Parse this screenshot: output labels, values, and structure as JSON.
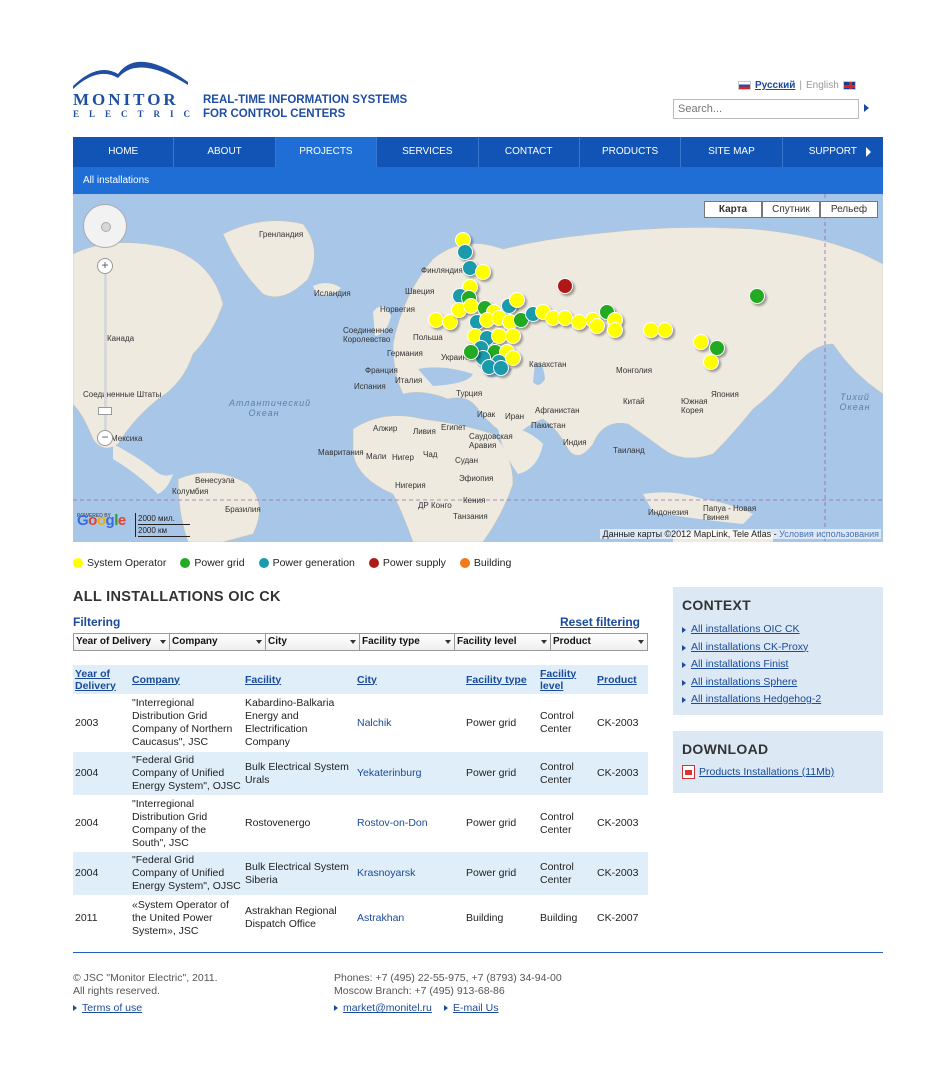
{
  "header": {
    "logo_word": "MONITOR",
    "logo_sub": "ELECTRIC",
    "tagline_1": "REAL-TIME INFORMATION SYSTEMS",
    "tagline_2": "FOR CONTROL CENTERS",
    "lang_ru": "Русский",
    "lang_sep": "|",
    "lang_en": "English",
    "search_placeholder": "Search..."
  },
  "nav": {
    "items": [
      "HOME",
      "ABOUT",
      "PROJECTS",
      "SERVICES",
      "CONTACT",
      "PRODUCTS",
      "SITE MAP",
      "SUPPORT"
    ],
    "active": "PROJECTS",
    "subnav": "All installations"
  },
  "map": {
    "type_buttons": [
      "Карта",
      "Спутник",
      "Рельеф"
    ],
    "active_type": "Карта",
    "labels": [
      "Гренландия",
      "Исландия",
      "Финляндия",
      "Швеция",
      "Норвегия",
      "Соединенное Королевство",
      "Польша",
      "Германия",
      "Украина",
      "Франция",
      "Испания",
      "Италия",
      "Турция",
      "Казахстан",
      "Монголия",
      "Китай",
      "Канада",
      "Соединенные Штаты",
      "Мексика",
      "Атлантический Океан",
      "Тихий Океан",
      "Алжир",
      "Ливия",
      "Египет",
      "Ирак",
      "Иран",
      "Афганистан",
      "Пакистан",
      "Индия",
      "Саудовская Аравия",
      "Мавритания",
      "Мали",
      "Нигер",
      "Чад",
      "Судан",
      "Эфиопия",
      "Нигерия",
      "Кения",
      "ДР Конго",
      "Танзания",
      "Венесуэла",
      "Колумбия",
      "Бразилия",
      "Индонезия",
      "Папуа - Новая Гвинея",
      "Таиланд",
      "Япония",
      "Южная Корея"
    ],
    "scale_miles": "2000 мил.",
    "scale_km": "2000 км",
    "google": "Google",
    "powered": "POWERED BY",
    "copyright": "Данные карты ©2012 MapLink, Tele Atlas -",
    "terms": "Условия использования",
    "zoom_in": "+",
    "zoom_out": "−"
  },
  "legend": [
    {
      "label": "System Operator",
      "color": "#ffff00"
    },
    {
      "label": "Power grid",
      "color": "#22aa22"
    },
    {
      "label": "Power generation",
      "color": "#1a9aaa"
    },
    {
      "label": "Power supply",
      "color": "#b01818"
    },
    {
      "label": "Building",
      "color": "#f07a18"
    }
  ],
  "main": {
    "title": "ALL INSTALLATIONS OIC CK",
    "filtering": "Filtering",
    "reset": "Reset filtering",
    "filters": [
      "Year of Delivery",
      "Company",
      "City",
      "Facility type",
      "Facility level",
      "Product"
    ],
    "columns": [
      "Year of Delivery",
      "Company",
      "Facility",
      "City",
      "Facility type",
      "Facility level",
      "Product"
    ],
    "rows": [
      {
        "year": "2003",
        "company": "\"Interregional Distribution Grid Company of Northern Caucasus\", JSC",
        "facility": "Kabardino-Balkaria Energy and Electrification Company",
        "city": "Nalchik",
        "type": "Power grid",
        "level": "Control Center",
        "product": "CK-2003"
      },
      {
        "year": "2004",
        "company": "\"Federal Grid Company of Unified Energy System\", OJSC",
        "facility": "Bulk Electrical System Urals",
        "city": "Yekaterinburg",
        "type": "Power grid",
        "level": "Control Center",
        "product": "CK-2003"
      },
      {
        "year": "2004",
        "company": "\"Interregional Distribution Grid Company of the South\", JSC",
        "facility": "Rostovenergo",
        "city": "Rostov-on-Don",
        "type": "Power grid",
        "level": "Control Center",
        "product": "CK-2003"
      },
      {
        "year": "2004",
        "company": "\"Federal Grid Company of Unified Energy System\", OJSC",
        "facility": "Bulk Electrical System Siberia",
        "city": "Krasnoyarsk",
        "type": "Power grid",
        "level": "Control Center",
        "product": "CK-2003"
      },
      {
        "year": "2011",
        "company": "«System Operator of the United Power System», JSC",
        "facility": "Astrakhan Regional Dispatch Office",
        "city": "Astrakhan",
        "type": "Building",
        "level": "Building",
        "product": "CK-2007"
      }
    ]
  },
  "sidebar": {
    "context_title": "CONTEXT",
    "context_links": [
      "All installations OIC CK",
      "All installations CK-Proxy",
      "All installations Finist",
      "All installations Sphere",
      "All installations Hedgehog-2"
    ],
    "download_title": "DOWNLOAD",
    "download_link": "Products Installations (11Mb)"
  },
  "footer": {
    "copy_1": "© JSC \"Monitor Electric\", 2011.",
    "copy_2": "All rights reserved.",
    "terms": "Terms of use",
    "phones": "Phones: +7 (495) 22-55-975, +7 (8793) 34-94-00",
    "moscow": "Moscow Branch: +7 (495) 913-68-86",
    "email_1": "market@monitel.ru",
    "email_2": "E-mail Us"
  }
}
